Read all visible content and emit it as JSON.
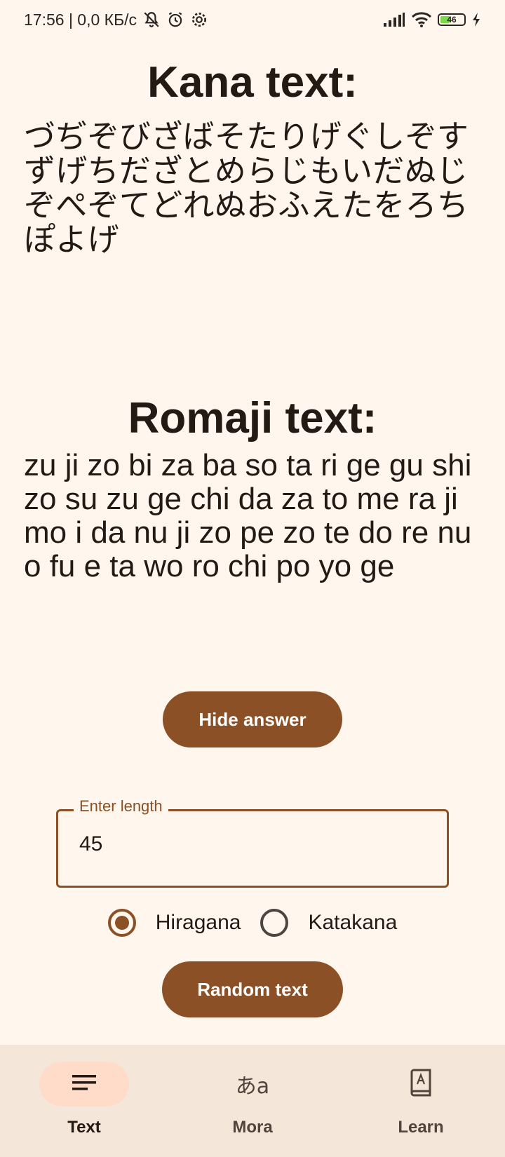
{
  "status_bar": {
    "left_text": "17:56 | 0,0 КБ/с",
    "battery": "46",
    "battery_level": 0.46
  },
  "kana": {
    "title": "Kana text:",
    "text": "づぢぞびざばそたりげぐしぞすずげちだざとめらじもいだぬじぞぺぞてどれぬおふえたをろちぽよげ"
  },
  "romaji": {
    "title": "Romaji text:",
    "text": "zu ji zo bi za ba so ta ri ge gu shi zo su zu ge chi da za to me ra ji mo i da nu ji zo pe zo te do re nu o fu e ta wo ro chi po yo ge"
  },
  "hide_button": {
    "label": "Hide answer"
  },
  "length_field": {
    "label": "Enter length",
    "value": "45"
  },
  "script_options": [
    {
      "label": "Hiragana",
      "selected": true
    },
    {
      "label": "Katakana",
      "selected": false
    }
  ],
  "random_button": {
    "label": "Random text"
  },
  "bottom_nav": {
    "items": [
      {
        "label": "Text",
        "icon": "notes-icon",
        "active": true
      },
      {
        "label": "Mora",
        "icon": "kana-a-icon",
        "glyph": "あa",
        "active": false
      },
      {
        "label": "Learn",
        "icon": "dictionary-book-icon",
        "active": false
      }
    ]
  },
  "colors": {
    "background": "#fff6ee",
    "primary": "#8b5025",
    "nav_background": "#f5e6da",
    "nav_active_indicator": "#ffdbca"
  }
}
